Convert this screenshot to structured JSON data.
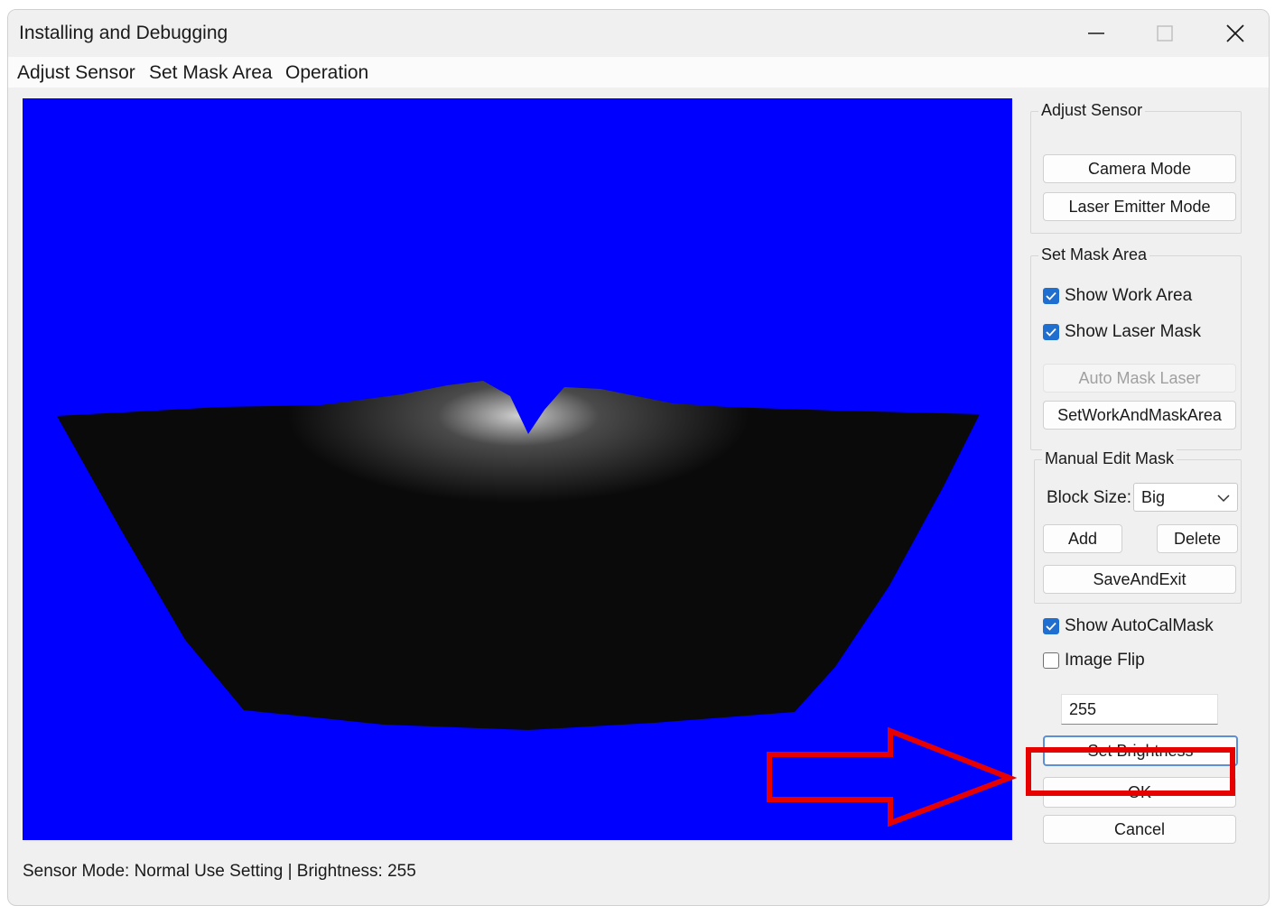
{
  "window": {
    "title": "Installing and Debugging"
  },
  "menu": {
    "items": [
      "Adjust Sensor",
      "Set Mask Area",
      "Operation"
    ]
  },
  "adjust_sensor": {
    "group_label": "Adjust Sensor",
    "camera_mode": "Camera Mode",
    "laser_emitter_mode": "Laser Emitter Mode"
  },
  "set_mask_area": {
    "group_label": "Set Mask Area",
    "show_work_area": {
      "label": "Show Work Area",
      "checked": true
    },
    "show_laser_mask": {
      "label": "Show Laser Mask",
      "checked": true
    },
    "auto_mask_laser": "Auto Mask Laser",
    "set_work_and_mask_area": "SetWorkAndMaskArea"
  },
  "manual_edit_mask": {
    "group_label": "Manual Edit Mask",
    "block_size_label": "Block Size:",
    "block_size_value": "Big",
    "add": "Add",
    "delete": "Delete",
    "save_and_exit": "SaveAndExit"
  },
  "options": {
    "show_autocal_mask": {
      "label": "Show AutoCalMask",
      "checked": true
    },
    "image_flip": {
      "label": "Image Flip",
      "checked": false
    }
  },
  "brightness": {
    "value": "255",
    "set_button": "Set Brightness"
  },
  "dialog_buttons": {
    "ok": "OK",
    "cancel": "Cancel"
  },
  "status_bar": {
    "text": "Sensor Mode: Normal Use Setting  |  Brightness: 255"
  },
  "colors": {
    "canvas_background": "#0000ff",
    "annotation": "#e60000",
    "checkbox_accent": "#1f6fd1"
  }
}
